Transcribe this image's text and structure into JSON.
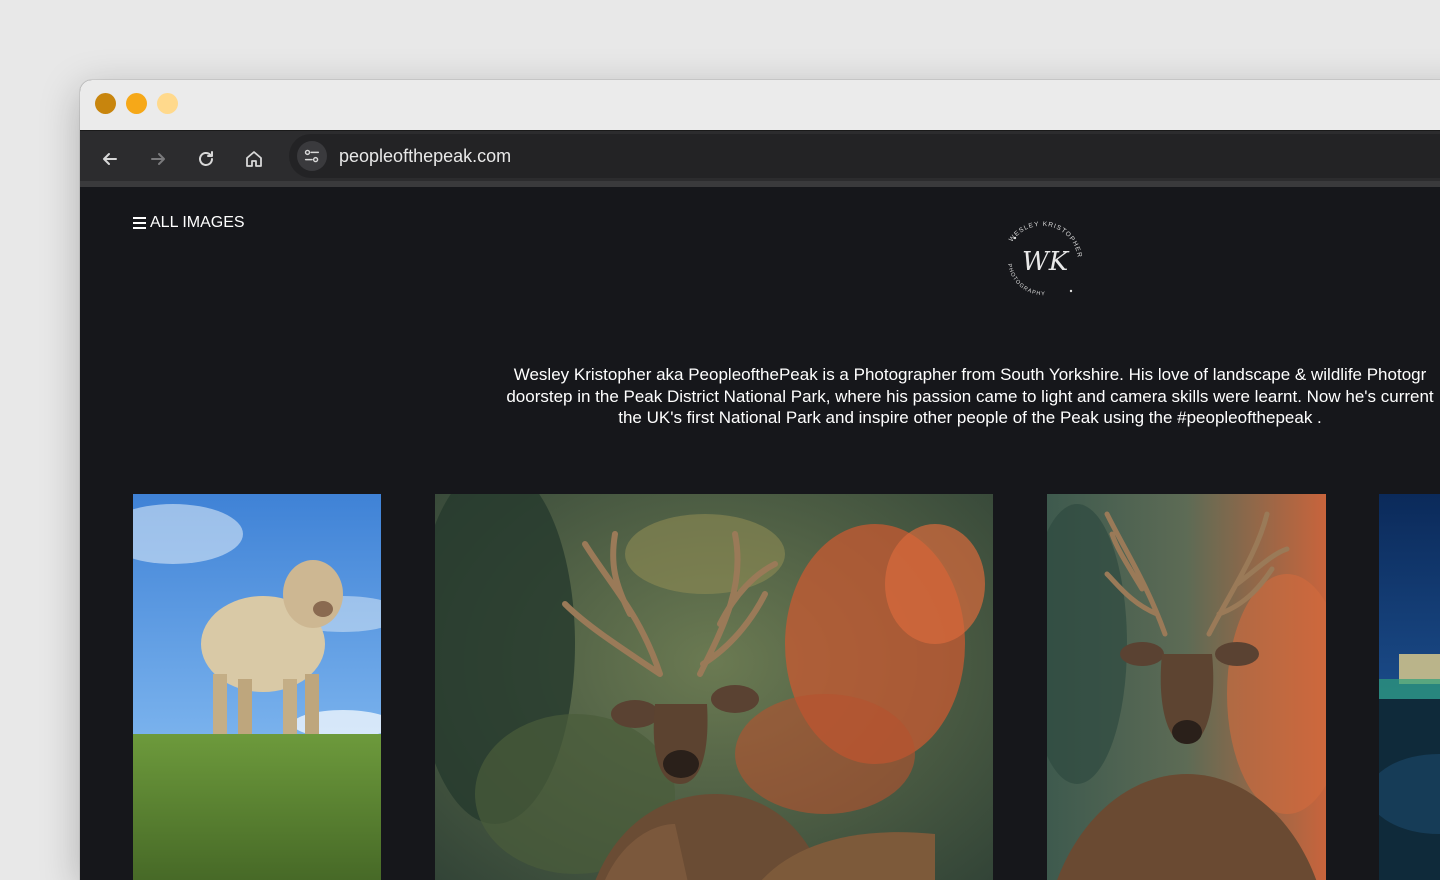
{
  "browser": {
    "url": "peopleofthepeak.com"
  },
  "site": {
    "menu_label": "ALL IMAGES",
    "logo_text_top": "WESLEY KRISTOPHER",
    "logo_text_bottom": "PHOTOGRAPHY",
    "logo_monogram": "WK",
    "bio_lines": [
      "Wesley Kristopher aka PeopleofthePeak is a Photographer from South Yorkshire. His love of landscape & wildlife Photogr",
      "doorstep in the Peak District National Park, where his passion came to light and camera skills were learnt. Now he's current",
      "the UK's first National Park and inspire other people of the Peak using the #peopleofthepeak ."
    ]
  },
  "gallery": [
    {
      "subject": "highland-calf-photo"
    },
    {
      "subject": "red-deer-stag-photo"
    },
    {
      "subject": "red-deer-stag-portrait-photo"
    },
    {
      "subject": "night-landscape-photo"
    }
  ],
  "colors": {
    "page_background": "#16171b",
    "toolbar": "#2c2c2e",
    "titlebar": "#ebebeb",
    "close": "#c8850d",
    "minimize": "#f6a818",
    "maximize": "#ffd98c"
  }
}
